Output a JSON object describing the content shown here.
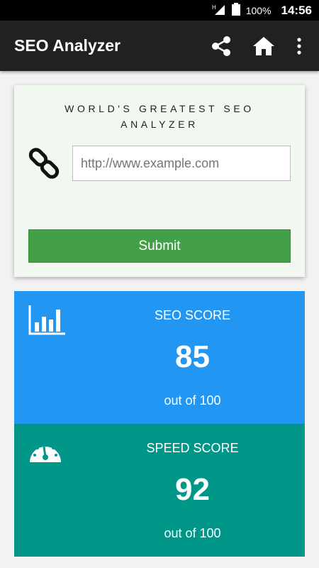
{
  "status_bar": {
    "network": "H",
    "battery": "100%",
    "time": "14:56"
  },
  "app_bar": {
    "title": "SEO Analyzer",
    "actions": [
      "share-icon",
      "home-icon",
      "more-vert-icon"
    ]
  },
  "analyzer": {
    "heading": "WORLD'S GREATEST SEO ANALYZER",
    "url_placeholder": "http://www.example.com",
    "url_value": "",
    "submit_label": "Submit"
  },
  "scores": {
    "seo": {
      "label": "SEO SCORE",
      "value": "85",
      "sub": "out of 100",
      "icon": "bar-chart-icon",
      "color": "#2196f3"
    },
    "speed": {
      "label": "SPEED SCORE",
      "value": "92",
      "sub": "out of 100",
      "icon": "speedometer-icon",
      "color": "#009688"
    }
  },
  "colors": {
    "app_bar": "#212121",
    "card_bg": "#f1f8ef",
    "submit": "#43a047"
  }
}
